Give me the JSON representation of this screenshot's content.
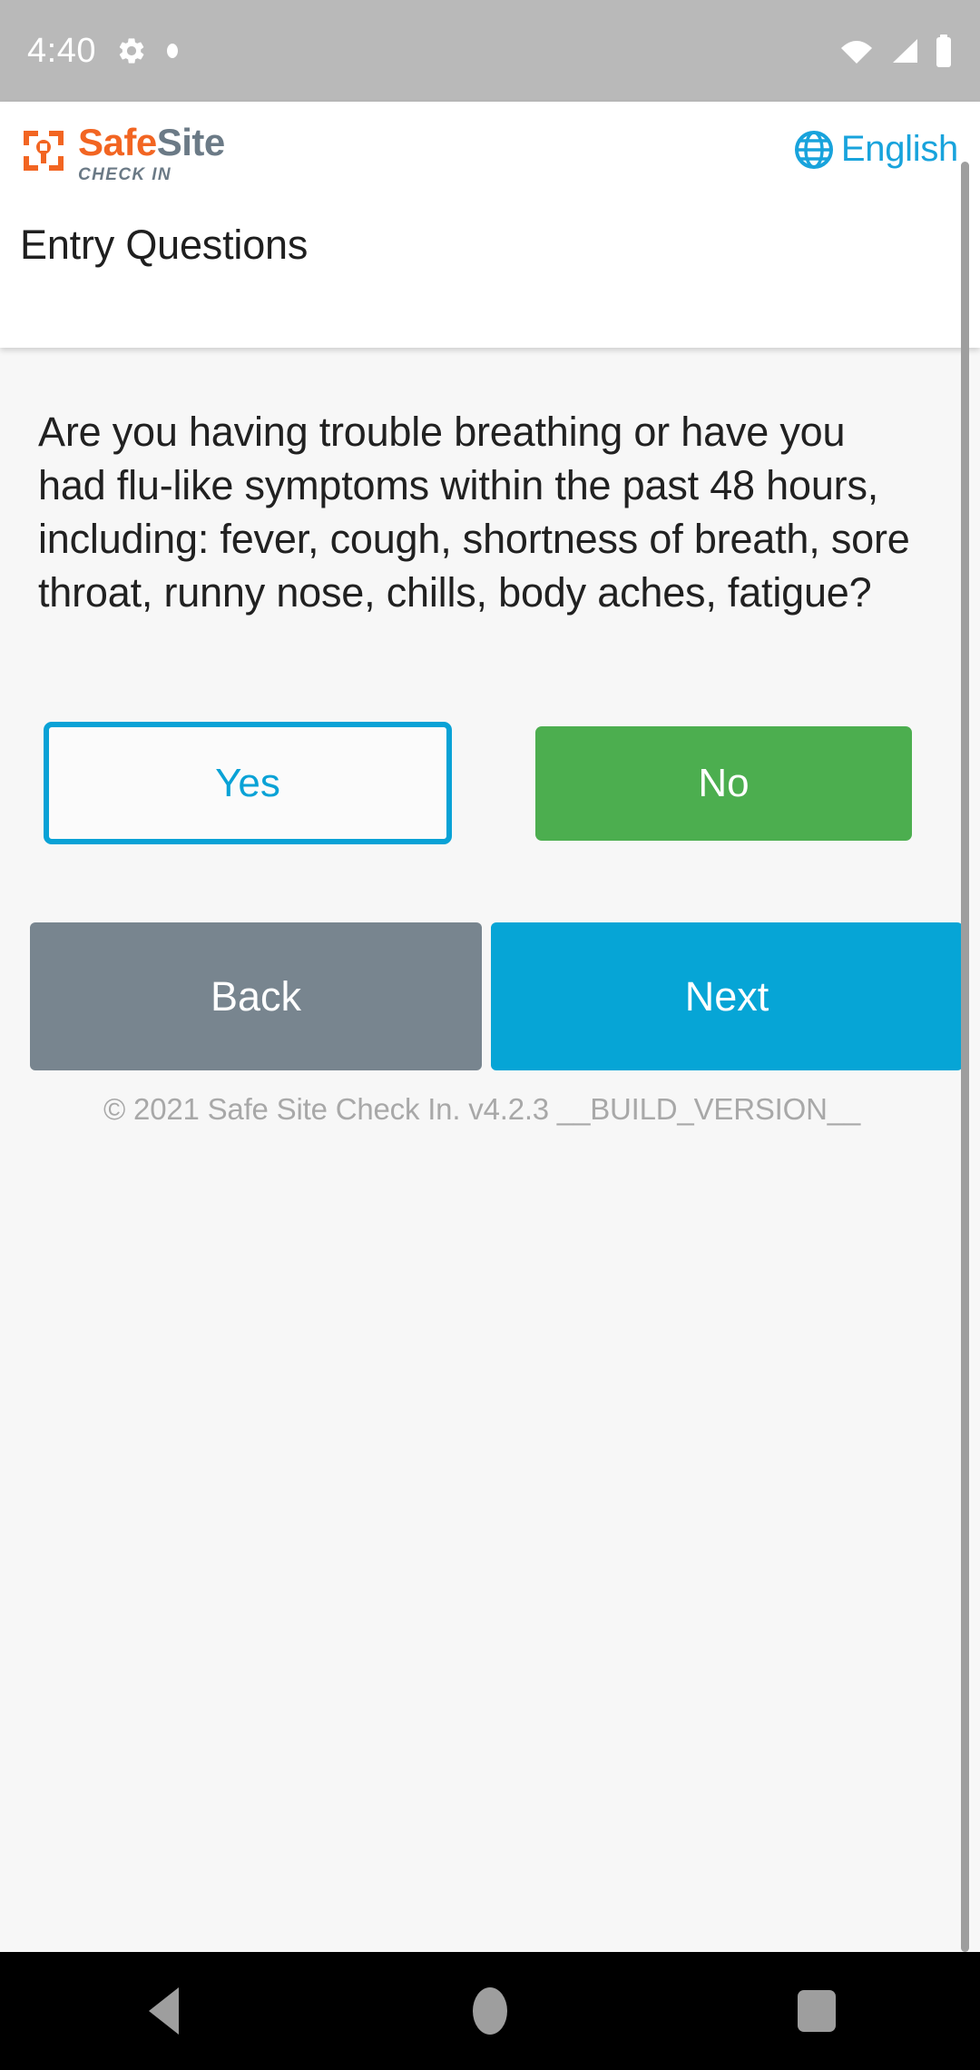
{
  "status_bar": {
    "time": "4:40",
    "icons_left": [
      "gear-icon",
      "dot-icon"
    ],
    "icons_right": [
      "wifi-icon",
      "cellular-signal-icon",
      "battery-icon"
    ]
  },
  "header": {
    "logo": {
      "mark": "safesite-logo-mark",
      "word_primary": "Safe",
      "word_secondary": "Site",
      "tagline": "CHECK IN"
    },
    "language": {
      "icon": "globe-icon",
      "label": "English"
    },
    "page_title": "Entry Questions"
  },
  "main": {
    "question": "Are you having trouble breathing or have you had flu-like symptoms within the past 48 hours, including: fever, cough, shortness of breath, sore throat, runny nose, chills, body aches, fatigue?",
    "answers": {
      "yes_label": "Yes",
      "no_label": "No",
      "selected": "No"
    },
    "navigation": {
      "back_label": "Back",
      "next_label": "Next"
    },
    "footer": "© 2021 Safe Site Check In. v4.2.3 __BUILD_VERSION__"
  },
  "system_nav": {
    "back": "nav-back-icon",
    "home": "nav-home-icon",
    "recents": "nav-recent-icon"
  },
  "colors": {
    "brand_orange": "#f26522",
    "brand_slate": "#6b7a86",
    "accent_cyan": "#06a5d6",
    "accent_cyan_light": "#18a3dc",
    "success_green": "#4cae4f",
    "neutral_gray": "#78858f",
    "status_bar_gray": "#b9b9b9",
    "content_bg": "#f7f7f7",
    "footer_gray": "#a8a8a8"
  }
}
